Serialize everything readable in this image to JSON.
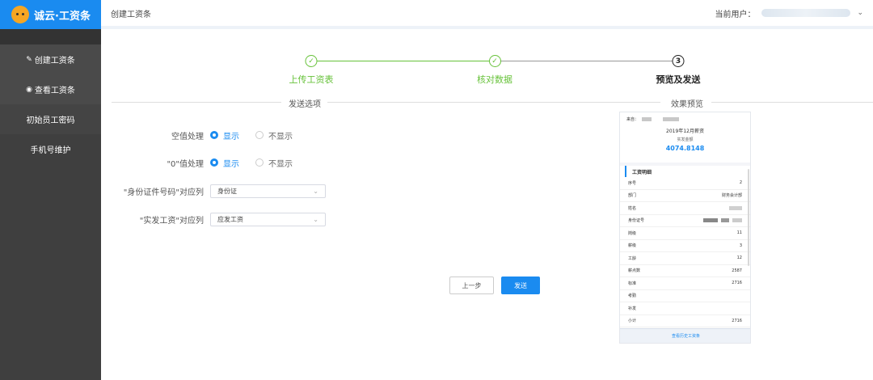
{
  "app": {
    "logo_text": "诚云·工资条"
  },
  "sidebar": {
    "items": [
      {
        "label": "创建工资条",
        "icon": "edit-icon"
      },
      {
        "label": "查看工资条",
        "icon": "eye-icon"
      },
      {
        "label": "初始员工密码"
      },
      {
        "label": "手机号维护"
      }
    ]
  },
  "header": {
    "breadcrumb": "创建工资条",
    "current_user_label": "当前用户："
  },
  "steps": [
    {
      "label": "上传工资表",
      "status": "done"
    },
    {
      "label": "核对数据",
      "status": "done"
    },
    {
      "label": "预览及发送",
      "status": "active",
      "number": "3"
    }
  ],
  "sections": {
    "options_title": "发送选项",
    "preview_title": "效果预览"
  },
  "form": {
    "empty_value": {
      "label": "空值处理",
      "options": [
        "显示",
        "不显示"
      ],
      "selected": "显示"
    },
    "zero_value": {
      "label": "\"0\"值处理",
      "options": [
        "显示",
        "不显示"
      ],
      "selected": "显示"
    },
    "id_column": {
      "label": "\"身份证件号码\"对应列",
      "value": "身份证"
    },
    "pay_column": {
      "label": "\"实发工资\"对应列",
      "value": "应发工资"
    }
  },
  "buttons": {
    "prev": "上一步",
    "send": "发送"
  },
  "preview": {
    "from_label": "来自：",
    "title": "2019年12月薪资",
    "subtitle": "实发金额",
    "amount": "4074.8148",
    "detail_title": "工资明细",
    "rows": [
      {
        "label": "序号",
        "value": "2"
      },
      {
        "label": "部门",
        "value": "财务会计部"
      },
      {
        "label": "姓名",
        "value": ""
      },
      {
        "label": "身份证号",
        "value": ""
      },
      {
        "label": "岗级",
        "value": "11"
      },
      {
        "label": "薪级",
        "value": "3"
      },
      {
        "label": "工龄",
        "value": "12"
      },
      {
        "label": "薪点数",
        "value": "2587"
      },
      {
        "label": "标准",
        "value": "2716"
      },
      {
        "label": "考勤",
        "value": ""
      },
      {
        "label": "补发",
        "value": ""
      },
      {
        "label": "小计",
        "value": "2716"
      }
    ],
    "history_button": "查看历史工资条"
  },
  "colors": {
    "primary": "#1a8bf0",
    "success": "#67c23a",
    "sidebar": "#3f3f3f"
  }
}
